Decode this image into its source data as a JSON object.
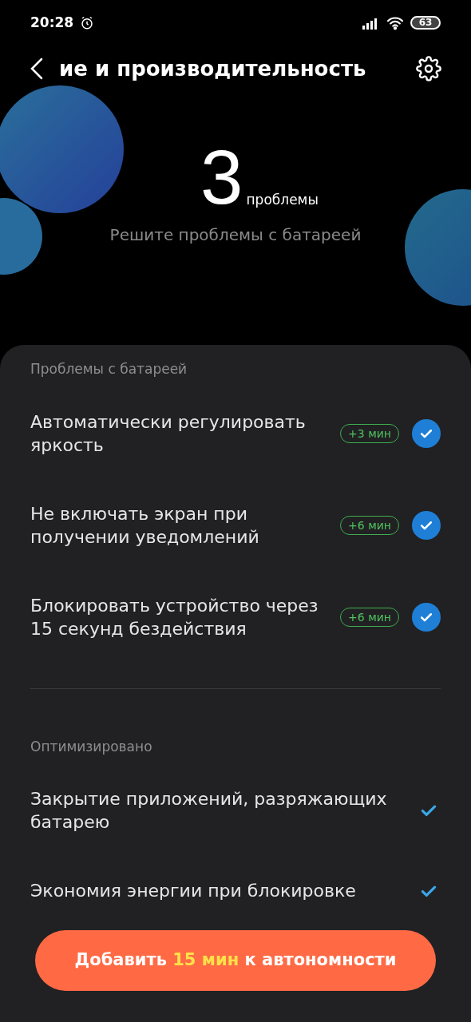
{
  "status_bar": {
    "time": "20:28",
    "battery": "63"
  },
  "header": {
    "title": "ие и производительность"
  },
  "summary": {
    "count": "3",
    "count_label": "проблемы",
    "subtitle": "Решите проблемы с батареей"
  },
  "sections": [
    {
      "title": "Проблемы с батареей",
      "items": [
        {
          "kind": "issue",
          "label": "Автоматически регулировать яркость",
          "gain": "+3 мин",
          "checked": true
        },
        {
          "kind": "issue",
          "label": "Не включать экран при получении уведомлений",
          "gain": "+6 мин",
          "checked": true
        },
        {
          "kind": "issue",
          "label": "Блокировать устройство через 15 секунд бездействия",
          "gain": "+6 мин",
          "checked": true
        }
      ]
    },
    {
      "title": "Оптимизировано",
      "items": [
        {
          "kind": "optimized",
          "label": "Закрытие приложений, разряжающих батарею",
          "checked": true
        },
        {
          "kind": "optimized",
          "label": "Экономия энергии при блокировке",
          "checked": true
        }
      ]
    }
  ],
  "action": {
    "prefix": "Добавить",
    "highlight": "15 мин",
    "suffix": "к автономности"
  }
}
